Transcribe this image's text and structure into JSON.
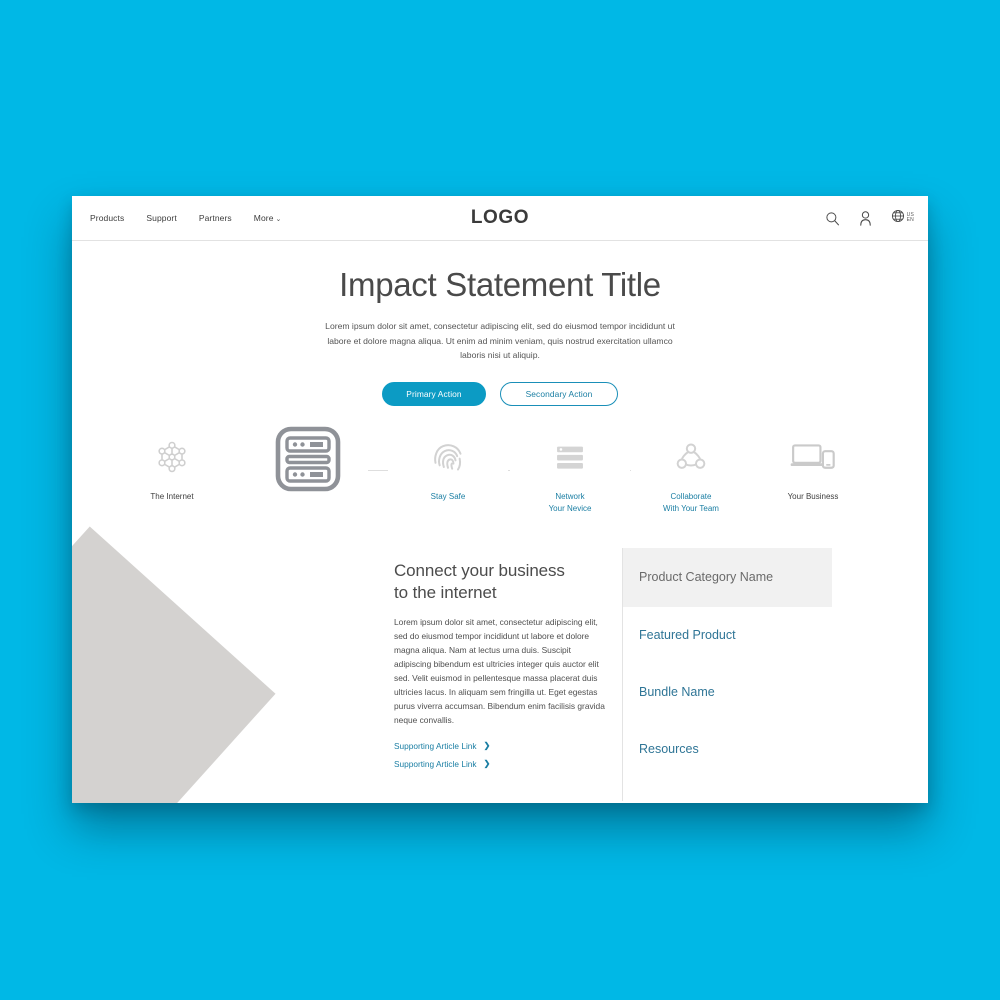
{
  "brand": {
    "logo": "LOGO"
  },
  "nav": {
    "items": [
      {
        "label": "Products",
        "caret": ""
      },
      {
        "label": "Support",
        "caret": ""
      },
      {
        "label": "Partners",
        "caret": ""
      },
      {
        "label": "More",
        "caret": "⌄"
      }
    ]
  },
  "header_actions": {
    "search_icon": "search-icon",
    "account_icon": "user-icon",
    "globe_icon": "globe-icon",
    "locale_line1": "US",
    "locale_line2": "EN"
  },
  "hero": {
    "title": "Impact Statement Title",
    "subtitle": "Lorem ipsum dolor sit amet, consectetur adipiscing elit, sed do eiusmod tempor incididunt ut labore et dolore magna aliqua. Ut enim ad minim veniam, quis nostrud exercitation ullamco laboris nisi ut aliquip.",
    "primary_action": "Primary Action",
    "secondary_action": "Secondary Action"
  },
  "journey": {
    "steps": [
      {
        "icon": "network-nodes-icon",
        "label": "The Internet",
        "is_link": false
      },
      {
        "icon": "server-rack-icon",
        "label": "",
        "is_link": false
      },
      {
        "icon": "fingerprint-icon",
        "label": "Stay Safe",
        "is_link": true
      },
      {
        "icon": "network-stack-icon",
        "label": "Network\nYour Nevice",
        "line1": "Network",
        "line2": "Your Nevice",
        "is_link": true
      },
      {
        "icon": "collaborate-triangle-icon",
        "label": "Collaborate\nWith Your Team",
        "line1": "Collaborate",
        "line2": "With Your Team",
        "is_link": true
      },
      {
        "icon": "laptop-phone-icon",
        "label": "Your Business",
        "is_link": false
      }
    ]
  },
  "article": {
    "title_line1": "Connect your business",
    "title_line2": "to the internet",
    "body": "Lorem ipsum dolor sit amet, consectetur adipiscing elit, sed do eiusmod tempor incididunt ut labore et dolore magna aliqua. Nam at lectus urna duis. Suscipit adipiscing bibendum est ultricies integer quis auctor elit sed. Velit euismod in pellentesque massa placerat duis ultricies lacus. In aliquam sem fringilla ut. Eget egestas purus viverra accumsan. Bibendum enim facilisis gravida neque convallis.",
    "links": [
      {
        "label": "Supporting Article Link",
        "chevron": "❯"
      },
      {
        "label": "Supporting Article Link",
        "chevron": "❯"
      }
    ]
  },
  "category_panel": {
    "header": "Product Category Name",
    "items": [
      {
        "label": "Featured Product"
      },
      {
        "label": "Bundle Name"
      },
      {
        "label": "Resources"
      }
    ]
  },
  "colors": {
    "background": "#00b8e6",
    "accent": "#0c9bc4",
    "link": "#1a7ea3",
    "panel_header_bg": "#f1f1f1",
    "decor_shape": "#d4d2d0",
    "icon_gray": "#9a9ca1"
  }
}
